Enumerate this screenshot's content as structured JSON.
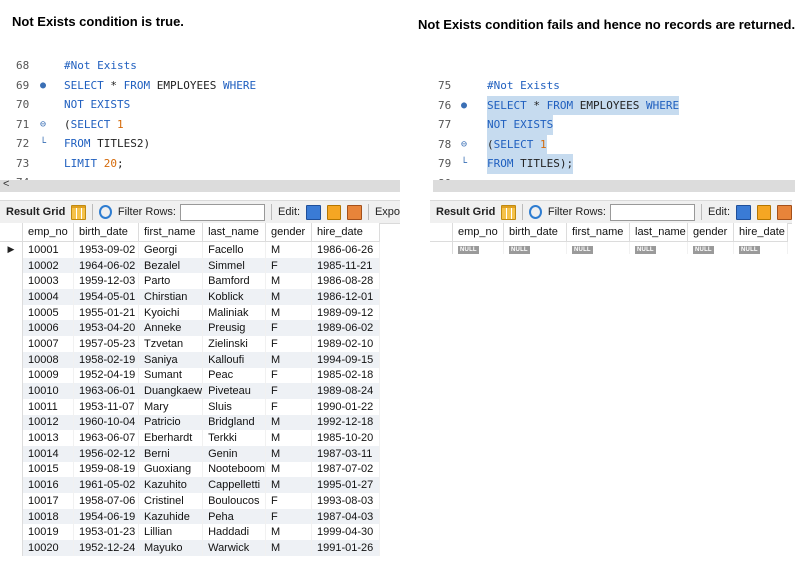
{
  "captions": {
    "left": "Not Exists condition is true.",
    "right": "Not Exists condition fails and hence no records are returned."
  },
  "editor_left": {
    "lines": [
      {
        "num": "68",
        "marker": "",
        "text": "#Not Exists",
        "tokens": [
          {
            "t": "#Not Exists",
            "c": "cmt"
          }
        ]
      },
      {
        "num": "69",
        "marker": "●",
        "tokens": [
          {
            "t": "SELECT",
            "c": "kw"
          },
          {
            "t": " * ",
            "c": "plain"
          },
          {
            "t": "FROM",
            "c": "kw"
          },
          {
            "t": " EMPLOYEES ",
            "c": "plain"
          },
          {
            "t": "WHERE",
            "c": "kw"
          }
        ]
      },
      {
        "num": "70",
        "marker": "",
        "tokens": [
          {
            "t": "NOT EXISTS",
            "c": "kw"
          }
        ]
      },
      {
        "num": "71",
        "marker": "⊖",
        "tokens": [
          {
            "t": "(",
            "c": "plain"
          },
          {
            "t": "SELECT",
            "c": "kw"
          },
          {
            "t": " ",
            "c": "plain"
          },
          {
            "t": "1",
            "c": "num"
          }
        ]
      },
      {
        "num": "72",
        "marker": "└",
        "tokens": [
          {
            "t": "FROM",
            "c": "kw"
          },
          {
            "t": " TITLES2)",
            "c": "plain"
          }
        ]
      },
      {
        "num": "73",
        "marker": "",
        "tokens": [
          {
            "t": "LIMIT",
            "c": "kw"
          },
          {
            "t": " ",
            "c": "plain"
          },
          {
            "t": "20",
            "c": "num"
          },
          {
            "t": ";",
            "c": "plain"
          }
        ]
      },
      {
        "num": "74",
        "marker": "",
        "tokens": []
      }
    ]
  },
  "editor_right": {
    "lines": [
      {
        "num": "75",
        "marker": "",
        "sel": false,
        "tokens": [
          {
            "t": "#Not Exists",
            "c": "cmt"
          }
        ]
      },
      {
        "num": "76",
        "marker": "●",
        "sel": true,
        "tokens": [
          {
            "t": "SELECT",
            "c": "kw"
          },
          {
            "t": " * ",
            "c": "plain"
          },
          {
            "t": "FROM",
            "c": "kw"
          },
          {
            "t": " EMPLOYEES ",
            "c": "plain"
          },
          {
            "t": "WHERE",
            "c": "kw"
          }
        ]
      },
      {
        "num": "77",
        "marker": "",
        "sel": true,
        "tokens": [
          {
            "t": "NOT EXISTS",
            "c": "kw"
          }
        ]
      },
      {
        "num": "78",
        "marker": "⊖",
        "sel": true,
        "tokens": [
          {
            "t": "(",
            "c": "plain"
          },
          {
            "t": "SELECT",
            "c": "kw"
          },
          {
            "t": " ",
            "c": "plain"
          },
          {
            "t": "1",
            "c": "num"
          }
        ]
      },
      {
        "num": "79",
        "marker": "└",
        "sel": true,
        "tokens": [
          {
            "t": "FROM",
            "c": "kw"
          },
          {
            "t": " TITLES);",
            "c": "plain"
          }
        ]
      },
      {
        "num": "80",
        "marker": "",
        "sel": false,
        "tokens": []
      }
    ]
  },
  "toolbar": {
    "result_grid": "Result Grid",
    "filter_rows": "Filter Rows:",
    "edit": "Edit:",
    "export_left": "Expo"
  },
  "scroll_arrow": "<",
  "grid": {
    "columns": [
      "emp_no",
      "birth_date",
      "first_name",
      "last_name",
      "gender",
      "hire_date"
    ],
    "rows": [
      [
        "10001",
        "1953-09-02",
        "Georgi",
        "Facello",
        "M",
        "1986-06-26"
      ],
      [
        "10002",
        "1964-06-02",
        "Bezalel",
        "Simmel",
        "F",
        "1985-11-21"
      ],
      [
        "10003",
        "1959-12-03",
        "Parto",
        "Bamford",
        "M",
        "1986-08-28"
      ],
      [
        "10004",
        "1954-05-01",
        "Chirstian",
        "Koblick",
        "M",
        "1986-12-01"
      ],
      [
        "10005",
        "1955-01-21",
        "Kyoichi",
        "Maliniak",
        "M",
        "1989-09-12"
      ],
      [
        "10006",
        "1953-04-20",
        "Anneke",
        "Preusig",
        "F",
        "1989-06-02"
      ],
      [
        "10007",
        "1957-05-23",
        "Tzvetan",
        "Zielinski",
        "F",
        "1989-02-10"
      ],
      [
        "10008",
        "1958-02-19",
        "Saniya",
        "Kalloufi",
        "M",
        "1994-09-15"
      ],
      [
        "10009",
        "1952-04-19",
        "Sumant",
        "Peac",
        "F",
        "1985-02-18"
      ],
      [
        "10010",
        "1963-06-01",
        "Duangkaew",
        "Piveteau",
        "F",
        "1989-08-24"
      ],
      [
        "10011",
        "1953-11-07",
        "Mary",
        "Sluis",
        "F",
        "1990-01-22"
      ],
      [
        "10012",
        "1960-10-04",
        "Patricio",
        "Bridgland",
        "M",
        "1992-12-18"
      ],
      [
        "10013",
        "1963-06-07",
        "Eberhardt",
        "Terkki",
        "M",
        "1985-10-20"
      ],
      [
        "10014",
        "1956-02-12",
        "Berni",
        "Genin",
        "M",
        "1987-03-11"
      ],
      [
        "10015",
        "1959-08-19",
        "Guoxiang",
        "Nooteboom",
        "M",
        "1987-07-02"
      ],
      [
        "10016",
        "1961-05-02",
        "Kazuhito",
        "Cappelletti",
        "M",
        "1995-01-27"
      ],
      [
        "10017",
        "1958-07-06",
        "Cristinel",
        "Bouloucos",
        "F",
        "1993-08-03"
      ],
      [
        "10018",
        "1954-06-19",
        "Kazuhide",
        "Peha",
        "F",
        "1987-04-03"
      ],
      [
        "10019",
        "1953-01-23",
        "Lillian",
        "Haddadi",
        "M",
        "1999-04-30"
      ],
      [
        "10020",
        "1952-12-24",
        "Mayuko",
        "Warwick",
        "M",
        "1991-01-26"
      ]
    ],
    "null_label": "NULL"
  }
}
